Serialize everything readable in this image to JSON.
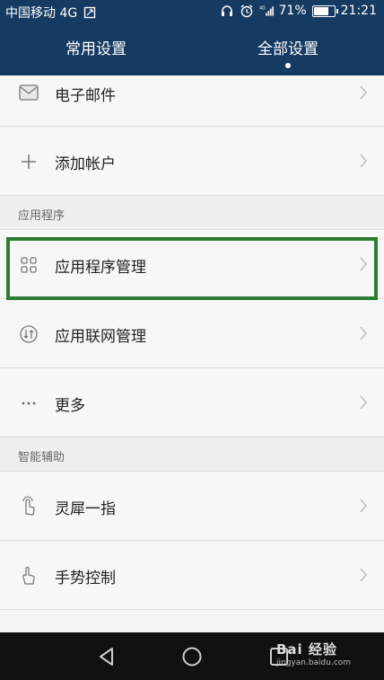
{
  "status_bar": {
    "carrier": "中国移动 4G",
    "network_type": "4G",
    "battery": "71%",
    "battery_level": 0.71,
    "time": "21:21"
  },
  "tabs": [
    {
      "label": "常用设置",
      "active": false
    },
    {
      "label": "全部设置",
      "active": true
    }
  ],
  "accounts": {
    "email_label": "电子邮件",
    "add_account_label": "添加帐户"
  },
  "sections": {
    "apps": "应用程序",
    "smart_assist": "智能辅助"
  },
  "apps": {
    "app_management": "应用程序管理",
    "network_apps": "应用联网管理",
    "more": "更多"
  },
  "smart_assist_items": {
    "knuckle": "灵犀一指",
    "gesture": "手势控制"
  },
  "watermark": {
    "brand": "Bai 经验",
    "url": "jingyan.baidu.com"
  },
  "colors": {
    "header_bg": "#163b62",
    "highlight": "#2e7d32"
  }
}
